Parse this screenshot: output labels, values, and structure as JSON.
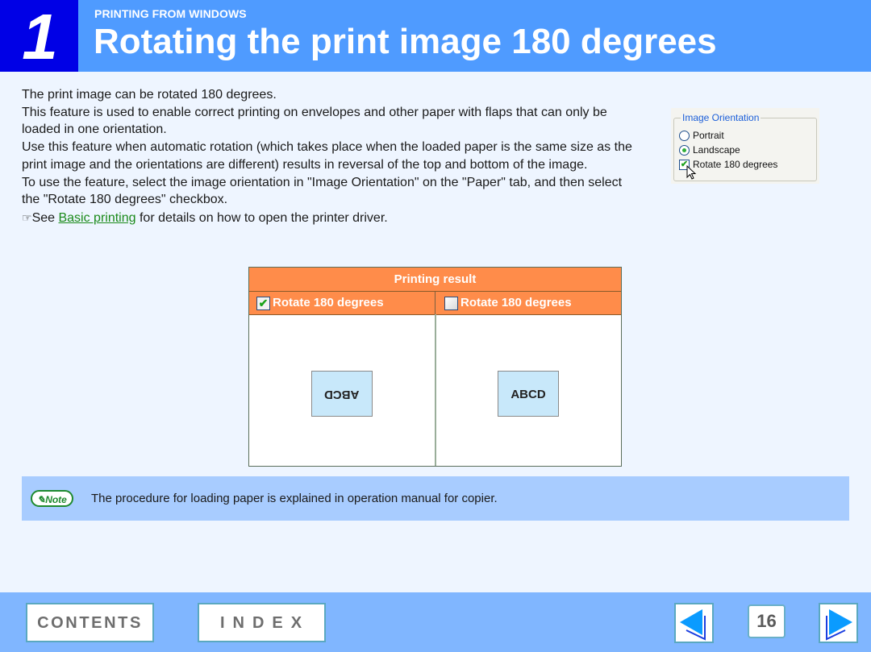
{
  "header": {
    "chapter_number": "1",
    "section_label": "PRINTING FROM WINDOWS",
    "title": "Rotating the print image 180 degrees"
  },
  "body": {
    "paragraphs": [
      "The print image can be rotated 180 degrees.",
      "This feature is used to enable correct printing on envelopes and other paper with flaps that can only be loaded in one orientation.",
      "Use this feature when automatic rotation (which takes place when the loaded paper is the same size as the print image and the orientations are different) results in reversal of the top and bottom of the image.",
      "To use the feature, select the image orientation in \"Image Orientation\" on the \"Paper\" tab, and then select the \"Rotate 180 degrees\" checkbox."
    ],
    "see": {
      "icon": "pointing-hand-icon",
      "prefix": "See ",
      "link_text": "Basic printing",
      "suffix": " for details on how to open the printer driver."
    }
  },
  "orientation_panel": {
    "legend": "Image Orientation",
    "options": [
      {
        "label": "Portrait",
        "type": "radio",
        "checked": false
      },
      {
        "label": "Landscape",
        "type": "radio",
        "checked": true
      },
      {
        "label": "Rotate 180 degrees",
        "type": "checkbox",
        "checked": true
      }
    ]
  },
  "result_table": {
    "title": "Printing result",
    "columns": [
      {
        "label": "Rotate 180 degrees",
        "checked": true,
        "check_glyph": "✔",
        "sample": "ABCD",
        "rotated": true
      },
      {
        "label": "Rotate 180 degrees",
        "checked": false,
        "check_glyph": "",
        "sample": "ABCD",
        "rotated": false
      }
    ]
  },
  "note": {
    "badge": "Note",
    "text": "The procedure for loading paper is explained in operation manual for copier."
  },
  "footer": {
    "contents_label": "CONTENTS",
    "index_label": "INDEX",
    "page_number": "16"
  },
  "colors": {
    "header_blue": "#4f9bff",
    "chapter_blue": "#0000e6",
    "table_orange": "#ff8c4a",
    "note_blue": "#a8ccff",
    "footer_blue": "#80b6ff",
    "link_green": "#1a8a1a"
  }
}
